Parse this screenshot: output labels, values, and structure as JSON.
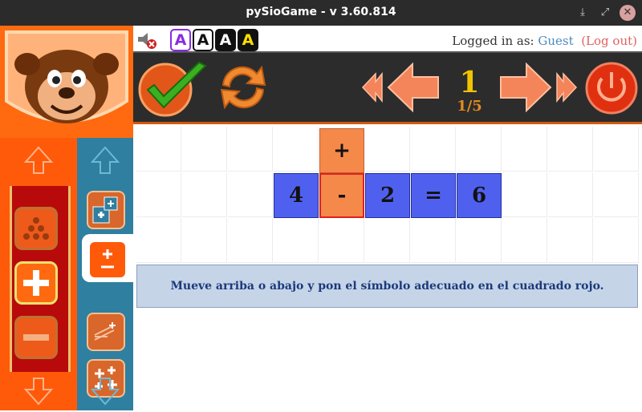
{
  "window": {
    "title": "pySioGame - v 3.60.814"
  },
  "header": {
    "font_buttons": [
      "A",
      "A",
      "A",
      "A"
    ],
    "login_prefix": "Logged in as:",
    "user": "Guest",
    "logout": "(Log out)"
  },
  "toolbar": {
    "level": "1",
    "level_progress": "1/5"
  },
  "game": {
    "row1": {
      "operator_above": "+"
    },
    "row2": {
      "num1": "4",
      "operator": "-",
      "num2": "2",
      "equals": "=",
      "result": "6"
    },
    "instruction": "Mueve arriba o abajo y pon el símbolo adecuado en el cuadrado rojo."
  },
  "colors": {
    "accent": "#ff5a0a",
    "tile_blue": "#5060ee",
    "tile_orange": "#f5894a",
    "level_yellow": "#f2c300"
  }
}
